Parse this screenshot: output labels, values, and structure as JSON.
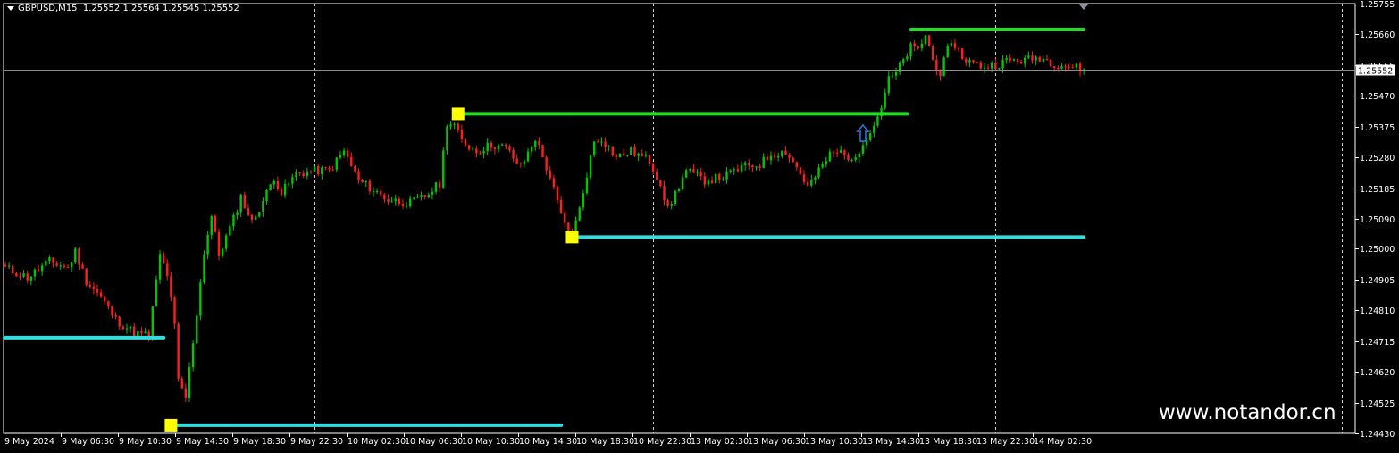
{
  "header": {
    "symbol": "GBPUSD,M15",
    "ohlc": "1.25552 1.25564 1.25545 1.25552"
  },
  "watermark": "www.notandor.cn",
  "colors": {
    "background": "#000000",
    "bull": "#00c800",
    "bear": "#ff1e1e",
    "resistance": "#22dd22",
    "support": "#33dddd",
    "marker": "#ffff00",
    "grid": "#cfcfcf",
    "arrow": "#2a6fd8"
  },
  "chart_data": {
    "type": "candlestick",
    "symbol": "GBPUSD",
    "timeframe": "M15",
    "ylim": [
      1.2443,
      1.25755
    ],
    "price_ticks": [
      "1.25755",
      "1.25660",
      "1.25565",
      "1.25470",
      "1.25375",
      "1.25280",
      "1.25185",
      "1.25090",
      "1.25000",
      "1.24905",
      "1.24810",
      "1.24715",
      "1.24620",
      "1.24525",
      "1.24430"
    ],
    "current_price": "1.25552",
    "time_labels": [
      "9 May 2024",
      "9 May 06:30",
      "9 May 10:30",
      "9 May 14:30",
      "9 May 18:30",
      "9 May 22:30",
      "10 May 02:30",
      "10 May 06:30",
      "10 May 10:30",
      "10 May 14:30",
      "10 May 18:30",
      "10 May 22:30",
      "13 May 02:30",
      "13 May 06:30",
      "13 May 10:30",
      "13 May 14:30",
      "13 May 18:30",
      "13 May 22:30",
      "14 May 02:30"
    ],
    "price_path": [
      [
        0,
        1.2494
      ],
      [
        6,
        1.2491
      ],
      [
        12,
        1.2496
      ],
      [
        17,
        1.2494
      ],
      [
        19,
        1.2499
      ],
      [
        22,
        1.249
      ],
      [
        26,
        1.2485
      ],
      [
        30,
        1.2478
      ],
      [
        35,
        1.2474
      ],
      [
        39,
        1.2473
      ],
      [
        42,
        1.2498
      ],
      [
        44,
        1.2492
      ],
      [
        46,
        1.2476
      ],
      [
        47,
        1.2459
      ],
      [
        49,
        1.2454
      ],
      [
        52,
        1.248
      ],
      [
        54,
        1.2499
      ],
      [
        56,
        1.251
      ],
      [
        58,
        1.2498
      ],
      [
        62,
        1.2509
      ],
      [
        64,
        1.2516
      ],
      [
        67,
        1.2508
      ],
      [
        71,
        1.2517
      ],
      [
        73,
        1.2522
      ],
      [
        75,
        1.2517
      ],
      [
        79,
        1.2523
      ],
      [
        84,
        1.2524
      ],
      [
        88,
        1.2524
      ],
      [
        92,
        1.253
      ],
      [
        96,
        1.2521
      ],
      [
        100,
        1.2518
      ],
      [
        104,
        1.2515
      ],
      [
        110,
        1.2514
      ],
      [
        114,
        1.2516
      ],
      [
        118,
        1.252
      ],
      [
        120,
        1.2539
      ],
      [
        122,
        1.2538
      ],
      [
        124,
        1.2533
      ],
      [
        128,
        1.253
      ],
      [
        132,
        1.2532
      ],
      [
        136,
        1.2531
      ],
      [
        140,
        1.2525
      ],
      [
        144,
        1.2534
      ],
      [
        148,
        1.2522
      ],
      [
        150,
        1.2514
      ],
      [
        152,
        1.2507
      ],
      [
        154,
        1.2504
      ],
      [
        156,
        1.2512
      ],
      [
        158,
        1.2523
      ],
      [
        160,
        1.2533
      ],
      [
        162,
        1.2534
      ],
      [
        166,
        1.2528
      ],
      [
        170,
        1.253
      ],
      [
        175,
        1.2527
      ],
      [
        178,
        1.252
      ],
      [
        180,
        1.2512
      ],
      [
        182,
        1.2517
      ],
      [
        185,
        1.2524
      ],
      [
        190,
        1.2521
      ],
      [
        195,
        1.2522
      ],
      [
        200,
        1.2525
      ],
      [
        205,
        1.2526
      ],
      [
        208,
        1.2529
      ],
      [
        212,
        1.253
      ],
      [
        215,
        1.2525
      ],
      [
        218,
        1.2519
      ],
      [
        220,
        1.2522
      ],
      [
        224,
        1.2529
      ],
      [
        228,
        1.253
      ],
      [
        230,
        1.2526
      ],
      [
        233,
        1.2533
      ],
      [
        236,
        1.2538
      ],
      [
        238,
        1.2544
      ],
      [
        240,
        1.2552
      ],
      [
        242,
        1.2554
      ],
      [
        244,
        1.2558
      ],
      [
        246,
        1.2562
      ],
      [
        248,
        1.2561
      ],
      [
        250,
        1.2566
      ],
      [
        252,
        1.2558
      ],
      [
        254,
        1.2554
      ],
      [
        256,
        1.2561
      ],
      [
        258,
        1.2563
      ],
      [
        260,
        1.2559
      ],
      [
        263,
        1.2557
      ],
      [
        266,
        1.2556
      ],
      [
        270,
        1.2557
      ],
      [
        273,
        1.2558
      ],
      [
        277,
        1.2558
      ],
      [
        281,
        1.2559
      ],
      [
        285,
        1.2557
      ],
      [
        290,
        1.2556
      ],
      [
        293,
        1.25552
      ]
    ],
    "levels": [
      {
        "type": "support",
        "price": 1.24725,
        "from_bar": 0,
        "to_bar": 43
      },
      {
        "type": "support",
        "price": 1.24455,
        "from_bar": 45,
        "to_bar": 151
      },
      {
        "type": "resistance",
        "price": 1.25415,
        "from_bar": 123,
        "to_bar": 245
      },
      {
        "type": "support",
        "price": 1.25035,
        "from_bar": 154,
        "to_bar": 293
      },
      {
        "type": "resistance",
        "price": 1.25675,
        "from_bar": 246,
        "to_bar": 293
      }
    ],
    "markers": [
      {
        "bar": 45,
        "price": 1.24455
      },
      {
        "bar": 123,
        "price": 1.25415
      },
      {
        "bar": 154,
        "price": 1.25035
      }
    ],
    "arrow": {
      "bar": 233,
      "price": 1.2535,
      "direction": "up"
    },
    "time_separators": [
      84,
      176,
      269,
      363
    ],
    "grid": false
  }
}
